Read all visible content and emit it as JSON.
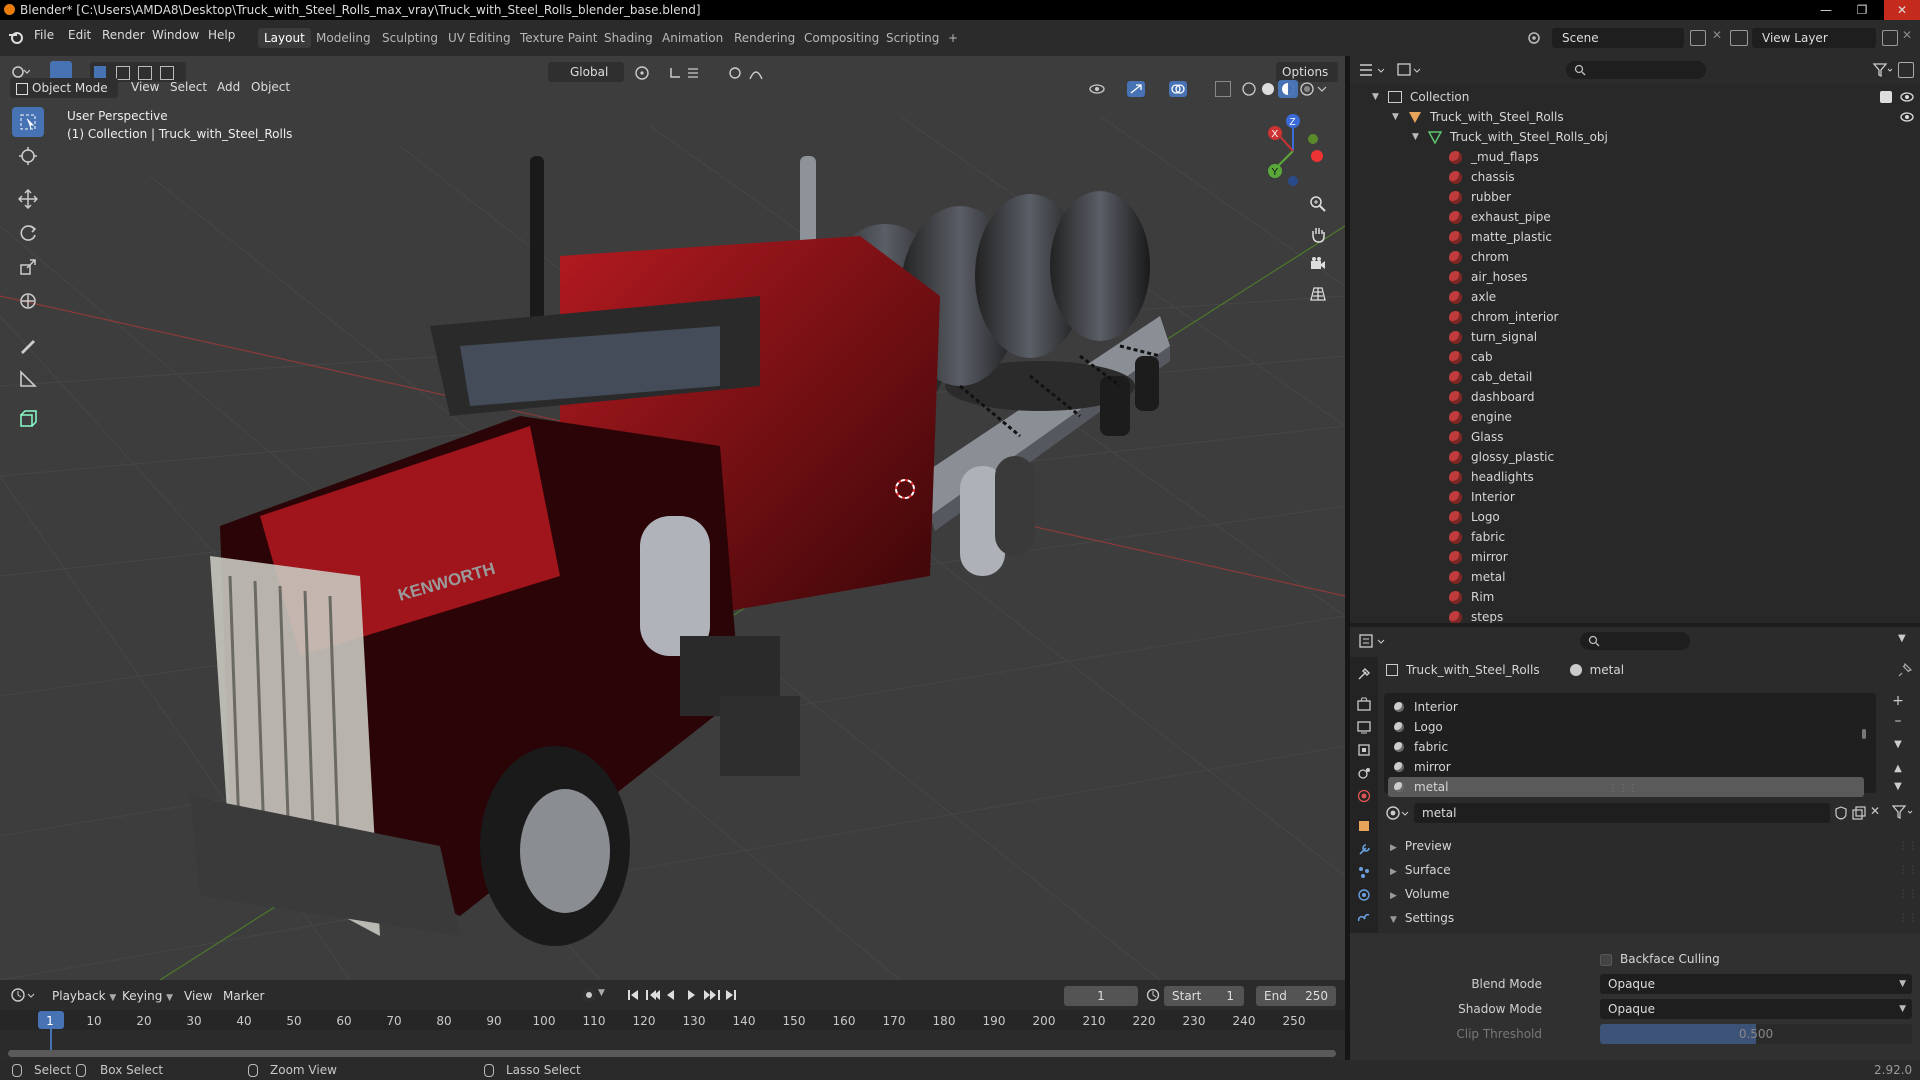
{
  "window": {
    "title": "Blender* [C:\\Users\\AMDA8\\Desktop\\Truck_with_Steel_Rolls_max_vray\\Truck_with_Steel_Rolls_blender_base.blend]"
  },
  "menu": [
    "File",
    "Edit",
    "Render",
    "Window",
    "Help"
  ],
  "workspaces": [
    "Layout",
    "Modeling",
    "Sculpting",
    "UV Editing",
    "Texture Paint",
    "Shading",
    "Animation",
    "Rendering",
    "Compositing",
    "Scripting",
    "+"
  ],
  "scene": {
    "name": "Scene",
    "view_layer": "View Layer"
  },
  "viewport": {
    "mode": "Object Mode",
    "menus": [
      "View",
      "Select",
      "Add",
      "Object"
    ],
    "transform_orientation": "Global",
    "options_label": "Options",
    "overlay_line1": "User Perspective",
    "overlay_line2": "(1) Collection | Truck_with_Steel_Rolls",
    "gizmo": {
      "z": "Z",
      "y": "Y",
      "x": "X"
    },
    "truck_logo": "KENWORTH"
  },
  "outliner": {
    "collection": "Collection",
    "object": "Truck_with_Steel_Rolls",
    "mesh": "Truck_with_Steel_Rolls_obj",
    "materials": [
      "_mud_flaps",
      "chassis",
      "rubber",
      "exhaust_pipe",
      "matte_plastic",
      "chrom",
      "air_hoses",
      "axle",
      "chrom_interior",
      "turn_signal",
      "cab",
      "cab_detail",
      "dashboard",
      "engine",
      "Glass",
      "glossy_plastic",
      "headlights",
      "Interior",
      "Logo",
      "fabric",
      "mirror",
      "metal",
      "Rim",
      "steps"
    ]
  },
  "properties": {
    "breadcrumb_object": "Truck_with_Steel_Rolls",
    "breadcrumb_material": "metal",
    "slots": [
      "Interior",
      "Logo",
      "fabric",
      "mirror",
      "metal"
    ],
    "selected_slot": "metal",
    "material_name": "metal",
    "sections": [
      "Preview",
      "Surface",
      "Volume",
      "Settings"
    ],
    "backface_culling": "Backface Culling",
    "blend_mode_label": "Blend Mode",
    "blend_mode": "Opaque",
    "shadow_mode_label": "Shadow Mode",
    "shadow_mode": "Opaque",
    "clip_threshold_label": "Clip Threshold",
    "clip_threshold": "0.500",
    "clip_threshold_fraction": 0.5
  },
  "timeline": {
    "menus": [
      "Playback",
      "Keying",
      "View",
      "Marker"
    ],
    "current_frame": "1",
    "start_label": "Start",
    "start": "1",
    "end_label": "End",
    "end": "250",
    "ruler": [
      "1",
      "10",
      "20",
      "30",
      "40",
      "50",
      "60",
      "70",
      "80",
      "90",
      "100",
      "110",
      "120",
      "130",
      "140",
      "150",
      "160",
      "170",
      "180",
      "190",
      "200",
      "210",
      "220",
      "230",
      "240",
      "250"
    ]
  },
  "status": {
    "select": "Select",
    "box_select": "Box Select",
    "zoom_view": "Zoom View",
    "lasso_select": "Lasso Select",
    "version": "2.92.0"
  },
  "colors": {
    "accent": "#4772b3",
    "material_icon": "#c03b3b",
    "truck_red": "#8b0f15"
  }
}
